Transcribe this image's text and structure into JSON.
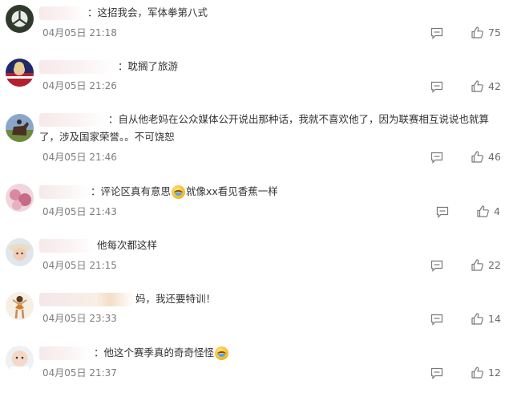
{
  "comments": [
    {
      "text": "：这招我会，军体拳第八式",
      "time": "04月05日 21:18",
      "likes": "75",
      "avatar": "panda-dark-avatar"
    },
    {
      "text": "：耽搁了旅游",
      "time": "04月05日 21:26",
      "likes": "42",
      "avatar": "flag-avatar"
    },
    {
      "text": "：自从他老妈在公众媒体公开说出那种话，我就不喜欢他了，因为联赛相互说说也就算了，涉及国家荣誉。。不可饶恕",
      "time": "04月05日 21:46",
      "likes": "46",
      "avatar": "horse-avatar"
    },
    {
      "text_before": "：评论区真有意思",
      "text_after": "就像xx看见香蕉一样",
      "time": "04月05日 21:43",
      "likes": "4",
      "avatar": "flower-avatar"
    },
    {
      "text": "他每次都这样",
      "time": "04月05日 21:15",
      "likes": "22",
      "avatar": "girl-hat-avatar"
    },
    {
      "text": "妈，我还要特训！",
      "time": "04月05日 23:33",
      "likes": "14",
      "avatar": "dancer-avatar"
    },
    {
      "text": "：他这个赛季真的奇奇怪怪",
      "time": "04月05日 21:37",
      "likes": "12",
      "avatar": "baby-avatar"
    }
  ],
  "icons": {
    "reply": "comment-icon",
    "like": "thumbs-up-icon"
  }
}
